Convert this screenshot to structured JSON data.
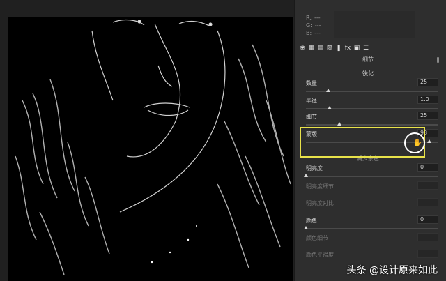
{
  "info": {
    "r_label": "R:",
    "r_value": "---",
    "g_label": "G:",
    "g_value": "---",
    "b_label": "B:",
    "b_value": "---"
  },
  "toolbar": {
    "icons": [
      "aperture-icon",
      "grid-icon",
      "tone-icon",
      "split-tone-icon",
      "lens-icon",
      "fx-icon",
      "camera-icon",
      "sliders-icon"
    ],
    "fx_label": "fx"
  },
  "panel": {
    "tab_title": "细节",
    "sharpen_title": "锐化",
    "noise_title": "减少杂色",
    "sliders": [
      {
        "label": "数量",
        "value": "25",
        "level": 0.17
      },
      {
        "label": "半径",
        "value": "1.0",
        "level": 0.18
      },
      {
        "label": "细节",
        "value": "25",
        "level": 0.25
      },
      {
        "label": "蒙版",
        "value": "93",
        "level": 0.93
      },
      {
        "label": "明亮度",
        "value": "0",
        "level": 0.0
      },
      {
        "label": "明亮度细节",
        "value": "",
        "level": null
      },
      {
        "label": "明亮度对比",
        "value": "",
        "level": null
      },
      {
        "label": "颜色",
        "value": "0",
        "level": 0.0
      },
      {
        "label": "颜色细节",
        "value": "",
        "level": null
      },
      {
        "label": "颜色平滑度",
        "value": "",
        "level": null
      }
    ]
  },
  "watermark": "头条 @设计原来如此",
  "colors": {
    "highlight": "#e8e24a",
    "panel": "#2e2e2e",
    "background": "#202020"
  }
}
